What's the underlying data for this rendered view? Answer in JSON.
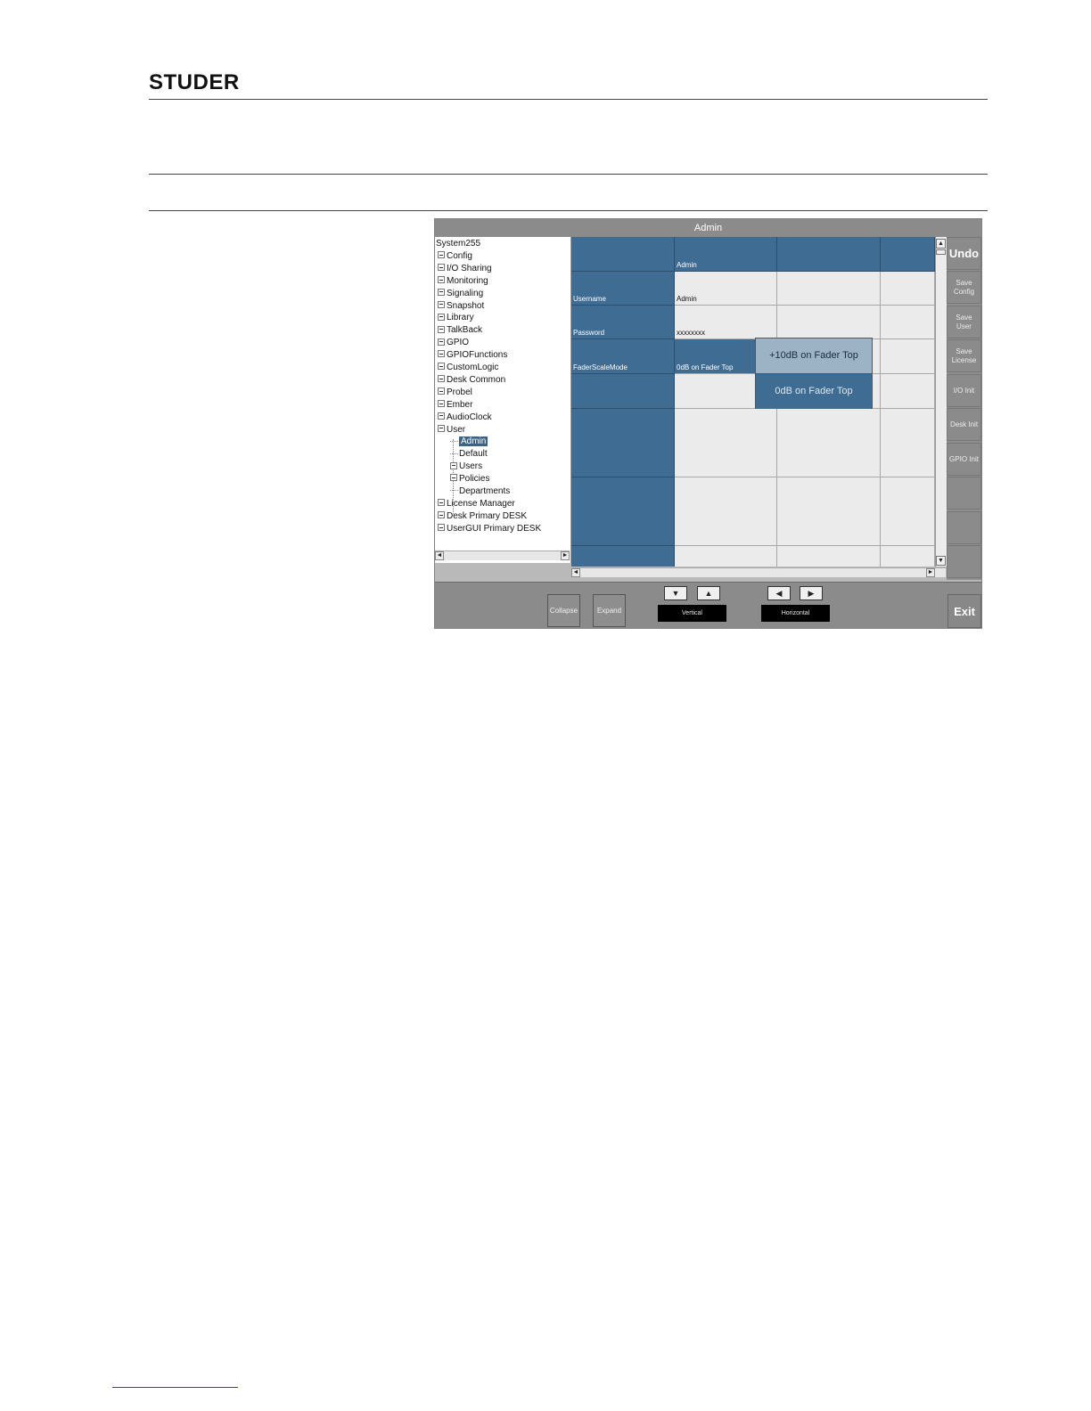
{
  "header": {
    "logo": "STUDER"
  },
  "window": {
    "title": "Admin",
    "tree": {
      "items": [
        {
          "label": "System255",
          "level": 0,
          "expander": false
        },
        {
          "label": "Config",
          "level": 1,
          "expander": true
        },
        {
          "label": "I/O Sharing",
          "level": 1,
          "expander": true
        },
        {
          "label": "Monitoring",
          "level": 1,
          "expander": true
        },
        {
          "label": "Signaling",
          "level": 1,
          "expander": true
        },
        {
          "label": "Snapshot",
          "level": 1,
          "expander": true
        },
        {
          "label": "Library",
          "level": 1,
          "expander": true
        },
        {
          "label": "TalkBack",
          "level": 1,
          "expander": true
        },
        {
          "label": "GPIO",
          "level": 1,
          "expander": true
        },
        {
          "label": "GPIOFunctions",
          "level": 1,
          "expander": true
        },
        {
          "label": "CustomLogic",
          "level": 1,
          "expander": true
        },
        {
          "label": "Desk Common",
          "level": 1,
          "expander": true
        },
        {
          "label": "Probel",
          "level": 1,
          "expander": true
        },
        {
          "label": "Ember",
          "level": 1,
          "expander": true
        },
        {
          "label": "AudioClock",
          "level": 1,
          "expander": true
        },
        {
          "label": "User",
          "level": 1,
          "expander": true
        },
        {
          "label": "Admin",
          "level": 2,
          "expander": false,
          "selected": true
        },
        {
          "label": "Default",
          "level": 2,
          "expander": false
        },
        {
          "label": "Users",
          "level": 2,
          "expander": true
        },
        {
          "label": "Policies",
          "level": 2,
          "expander": true
        },
        {
          "label": "Departments",
          "level": 2,
          "expander": false
        },
        {
          "label": "License Manager",
          "level": 1,
          "expander": true
        },
        {
          "label": "Desk Primary DESK",
          "level": 1,
          "expander": true
        },
        {
          "label": "UserGUI Primary DESK",
          "level": 1,
          "expander": true
        }
      ]
    },
    "grid": {
      "column_header": "Admin",
      "rows": [
        {
          "label": "Username",
          "value": "Admin"
        },
        {
          "label": "Password",
          "value": "xxxxxxxx"
        },
        {
          "label": "FaderScaleMode",
          "value": "0dB on Fader Top"
        }
      ]
    },
    "dropdown": {
      "options": [
        "+10dB on Fader Top",
        "0dB on Fader Top"
      ],
      "highlighted_index": 0
    },
    "side_buttons": {
      "undo": "Undo",
      "save_config": "Save\nConfig",
      "save_user": "Save\nUser",
      "save_license": "Save\nLicense",
      "io_init": "I/O Init",
      "desk_init": "Desk Init",
      "gpio_init": "GPIO Init"
    },
    "bottom": {
      "collapse": "Collapse",
      "expand": "Expand",
      "vertical_label": "Vertical",
      "horizontal_label": "Horizontal",
      "exit": "Exit"
    },
    "icons": {
      "down": "▼",
      "up": "▲",
      "left": "◀",
      "right": "▶",
      "small_left": "◄",
      "small_right": "►",
      "small_up": "▲",
      "small_down": "▼"
    },
    "colors": {
      "header_cell": "#3f6c93",
      "value_cell": "#ebebeb",
      "popup_highlight": "#9cb3c6",
      "selection": "#3b6386"
    }
  }
}
